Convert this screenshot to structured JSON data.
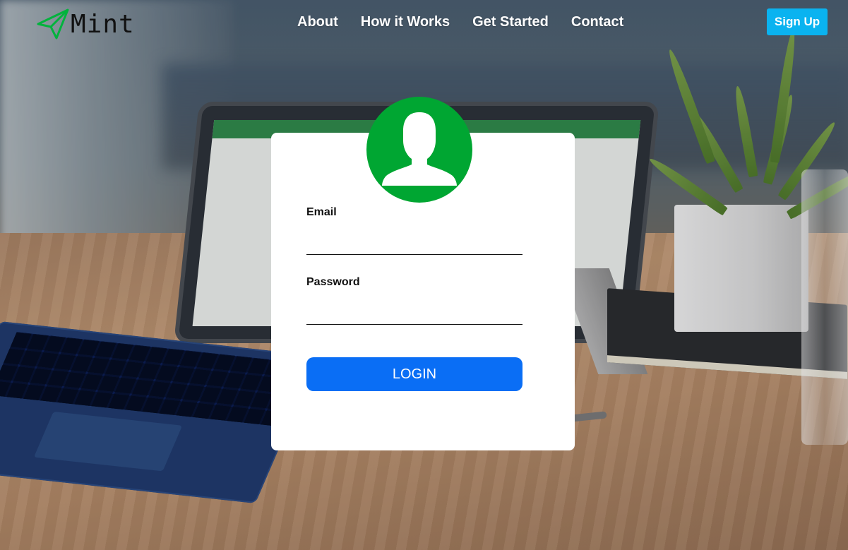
{
  "brand": {
    "name": "Mint",
    "logo_icon": "paper-plane-icon",
    "accent_color": "#00a632"
  },
  "nav": {
    "items": [
      {
        "label": "About"
      },
      {
        "label": "How it Works"
      },
      {
        "label": "Get Started"
      },
      {
        "label": "Contact"
      }
    ],
    "signup_label": "Sign Up",
    "signup_color": "#0ab3f0"
  },
  "login": {
    "avatar_icon": "user-silhouette-icon",
    "email_label": "Email",
    "email_value": "",
    "password_label": "Password",
    "password_value": "",
    "button_label": "LOGIN",
    "button_color": "#0a6ef5"
  }
}
